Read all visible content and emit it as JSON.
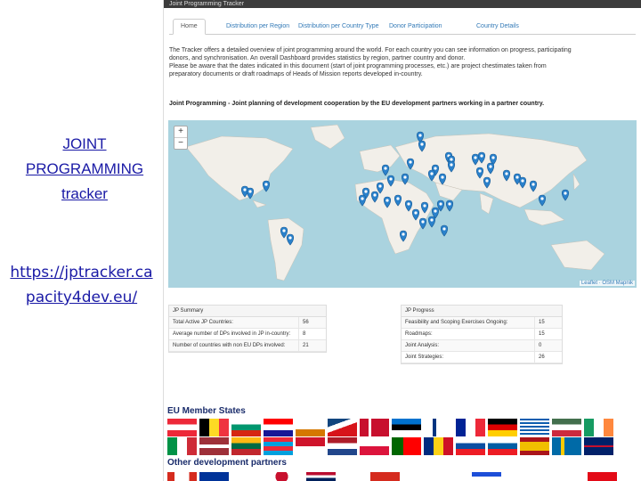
{
  "left": {
    "tracker_link": [
      "JOINT",
      "PROGRAMMING",
      "tracker"
    ],
    "url_link": [
      "https://jptracker.ca",
      "pacity4dev.eu/"
    ]
  },
  "app": {
    "title": "Joint Programming Tracker",
    "tabs": [
      {
        "label": "Home"
      },
      {
        "label": "Distribution per Region"
      },
      {
        "label": "Distribution per Country Type"
      },
      {
        "label": "Donor Participation"
      },
      {
        "label": "Country Details"
      }
    ],
    "intro": [
      "The Tracker offers a detailed overview of joint programming around the world. For each country you can see information on progress, participating",
      "donors, and synchronisation. An overall Dashboard provides statistics by region, partner country and donor.",
      "Please be aware that the dates indicated in this document (start of joint programming processes, etc.) are project chestimates taken from",
      "preparatory documents or draft roadmaps of Heads of Mission reports developed in-country."
    ],
    "section_title": "Joint Programming - Joint planning of development cooperation by the EU development partners working in a partner country.",
    "map": {
      "zoom_in": "+",
      "zoom_out": "−",
      "attribution": "Leaflet · OSM Mapnik"
    },
    "jp_summary": {
      "header": "JP Summary",
      "rows": [
        {
          "label": "Total Active JP Countries:",
          "value": "56"
        },
        {
          "label": "Average number of DPs involved in JP in-country:",
          "value": "8"
        },
        {
          "label": "Number of countries with non EU DPs involved:",
          "value": "21"
        }
      ]
    },
    "jp_progress": {
      "header": "JP Progress",
      "rows": [
        {
          "label": "Feasibility and Scoping Exercises Ongoing:",
          "value": "15"
        },
        {
          "label": "Roadmaps:",
          "value": "15"
        },
        {
          "label": "Joint Analysis:",
          "value": "0"
        },
        {
          "label": "Joint Strategies:",
          "value": "26"
        }
      ]
    }
  },
  "flags": {
    "eu_title": "EU Member States",
    "other_title": "Other development partners"
  },
  "colors": {
    "link": "#1a1aa6",
    "marker": "#2a81cb",
    "ocean": "#aad3df",
    "land": "#f2efe9"
  }
}
